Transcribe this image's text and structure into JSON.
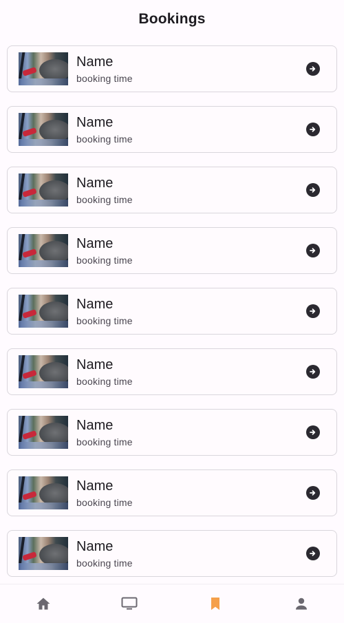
{
  "appbar": {
    "title": "Bookings"
  },
  "bookings": [
    {
      "name": "Name",
      "time": "booking time"
    },
    {
      "name": "Name",
      "time": "booking time"
    },
    {
      "name": "Name",
      "time": "booking time"
    },
    {
      "name": "Name",
      "time": "booking time"
    },
    {
      "name": "Name",
      "time": "booking time"
    },
    {
      "name": "Name",
      "time": "booking time"
    },
    {
      "name": "Name",
      "time": "booking time"
    },
    {
      "name": "Name",
      "time": "booking time"
    },
    {
      "name": "Name",
      "time": "booking time"
    }
  ],
  "icons": {
    "booking_action": "arrow-circle-right-icon",
    "nav": [
      "home-icon",
      "monitor-icon",
      "bookmark-icon",
      "person-icon"
    ]
  },
  "colors": {
    "active_nav": "#f5a04a",
    "inactive_nav": "#6b6870",
    "arrow_bg": "#2b2930"
  },
  "nav": {
    "active_index": 2
  }
}
